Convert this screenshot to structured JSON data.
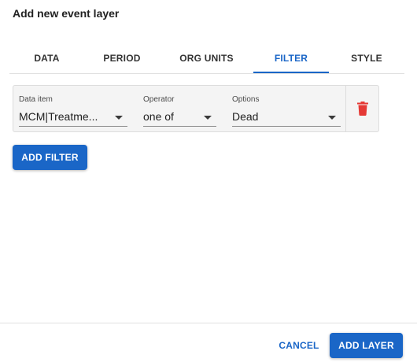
{
  "dialog": {
    "title": "Add new event layer"
  },
  "tabs": [
    {
      "label": "DATA",
      "active": false
    },
    {
      "label": "PERIOD",
      "active": false
    },
    {
      "label": "ORG UNITS",
      "active": false
    },
    {
      "label": "FILTER",
      "active": true
    },
    {
      "label": "STYLE",
      "active": false
    }
  ],
  "filter": {
    "data_item": {
      "label": "Data item",
      "value": "MCM|Treatme..."
    },
    "operator": {
      "label": "Operator",
      "value": "one of"
    },
    "options": {
      "label": "Options",
      "value": "Dead"
    },
    "delete_icon": "trash-icon"
  },
  "add_filter_label": "ADD FILTER",
  "footer": {
    "cancel_label": "CANCEL",
    "add_layer_label": "ADD LAYER"
  },
  "colors": {
    "accent": "#1a66c7",
    "delete": "#e53935"
  }
}
